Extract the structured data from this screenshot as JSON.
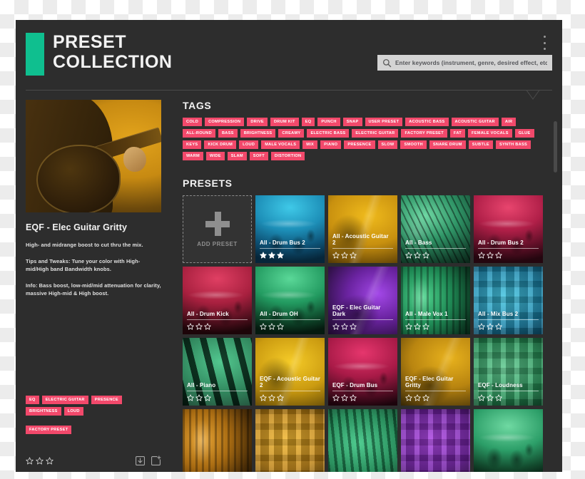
{
  "header": {
    "title_line1": "PRESET",
    "title_line2": "COLLECTION",
    "accent_color": "#0fbf8f",
    "menu_icon": "kebab-menu-icon",
    "search": {
      "placeholder": "Enter keywords (instrument, genre, desired effect, etc.)",
      "value": "",
      "icon": "search-icon"
    }
  },
  "left_panel": {
    "photo_alt": "electric-guitar-player-photo",
    "preset_name": "EQF - Elec Guitar Gritty",
    "description": [
      "High- and midrange boost to cut thru the mix.",
      "Tips and Tweaks: Tune your color with High-mid/High band Bandwidth knobs.",
      "Info: Bass boost, low-mid/mid attenuation for clarity, massive High-mid & High boost."
    ],
    "tags_row1": [
      "EQ",
      "ELECTRIC GUITAR",
      "PRESENCE"
    ],
    "tags_row2": [
      "BRIGHTNESS",
      "LOUD"
    ],
    "tags_row3": [
      "FACTORY PRESET"
    ],
    "rating": 0,
    "max_rating": 3,
    "footer_icons": [
      "download-icon",
      "add-to-collection-icon"
    ]
  },
  "tags_section": {
    "title": "TAGS",
    "tag_color": "#f2496b",
    "tags": [
      "COLD",
      "COMPRESSION",
      "DRIVE",
      "DRUM KIT",
      "EQ",
      "PUNCH",
      "SNAP",
      "USER PRESET",
      "ACOUSTIC BASS",
      "ACOUSTIC GUITAR",
      "AIR",
      "ALL-ROUND",
      "BASS",
      "BRIGHTNESS",
      "CREAMY",
      "ELECTRIC BASS",
      "ELECTRIC GUITAR",
      "FACTORY PRESET",
      "FAT",
      "FEMALE VOCALS",
      "GLUE",
      "KEYS",
      "KICK DRUM",
      "LOUD",
      "MALE VOCALS",
      "MIX",
      "PIANO",
      "PRESENCE",
      "SLOW",
      "SMOOTH",
      "SNARE DRUM",
      "SUBTLE",
      "SYNTH BASS",
      "WARM",
      "WIDE",
      "SLAM",
      "SOFT",
      "DISTORTION"
    ]
  },
  "presets_section": {
    "title": "PRESETS",
    "add_preset_label": "ADD PRESET",
    "max_rating": 3,
    "cards": [
      {
        "name": "All - Drum Bus 2",
        "rating": 3,
        "art": "drums-cyan",
        "selected": false
      },
      {
        "name": "All - Acoustic Guitar 2",
        "rating": 0,
        "art": "acoustic-gold",
        "selected": false
      },
      {
        "name": "All - Bass",
        "rating": 0,
        "art": "bass-green",
        "selected": false
      },
      {
        "name": "All - Drum Bus 2",
        "rating": 0,
        "art": "drums-crimson",
        "selected": false
      },
      {
        "name": "All - Drum Kick",
        "rating": 0,
        "art": "drums-red",
        "selected": false
      },
      {
        "name": "All - Drum OH",
        "rating": 0,
        "art": "drums-emerald",
        "selected": false
      },
      {
        "name": "EQF - Elec Guitar Dark",
        "rating": 0,
        "art": "elecguitar-purple",
        "selected": false
      },
      {
        "name": "All - Male Vox 1",
        "rating": 0,
        "art": "mic-green",
        "selected": false
      },
      {
        "name": "All - Mix Bus 2",
        "rating": 0,
        "art": "knobs-cyan",
        "selected": false
      },
      {
        "name": "All - Piano",
        "rating": 0,
        "art": "piano-green",
        "selected": false
      },
      {
        "name": "EQF - Acoustic Guitar 2",
        "rating": 0,
        "art": "acoustic-yellow",
        "selected": false
      },
      {
        "name": "EQF - Drum Bus",
        "rating": 0,
        "art": "drums-magenta",
        "selected": false
      },
      {
        "name": "EQF - Elec Guitar Gritty",
        "rating": 0,
        "art": "elecguitar-gold",
        "selected": true
      },
      {
        "name": "EQF - Loudness",
        "rating": 0,
        "art": "knobs-green",
        "selected": false
      }
    ],
    "cards_row4_partial": [
      {
        "art": "mic-orange"
      },
      {
        "art": "knobs-orange"
      },
      {
        "art": "synth-green"
      },
      {
        "art": "knobs-purple"
      },
      {
        "art": "drums-mint"
      }
    ]
  }
}
